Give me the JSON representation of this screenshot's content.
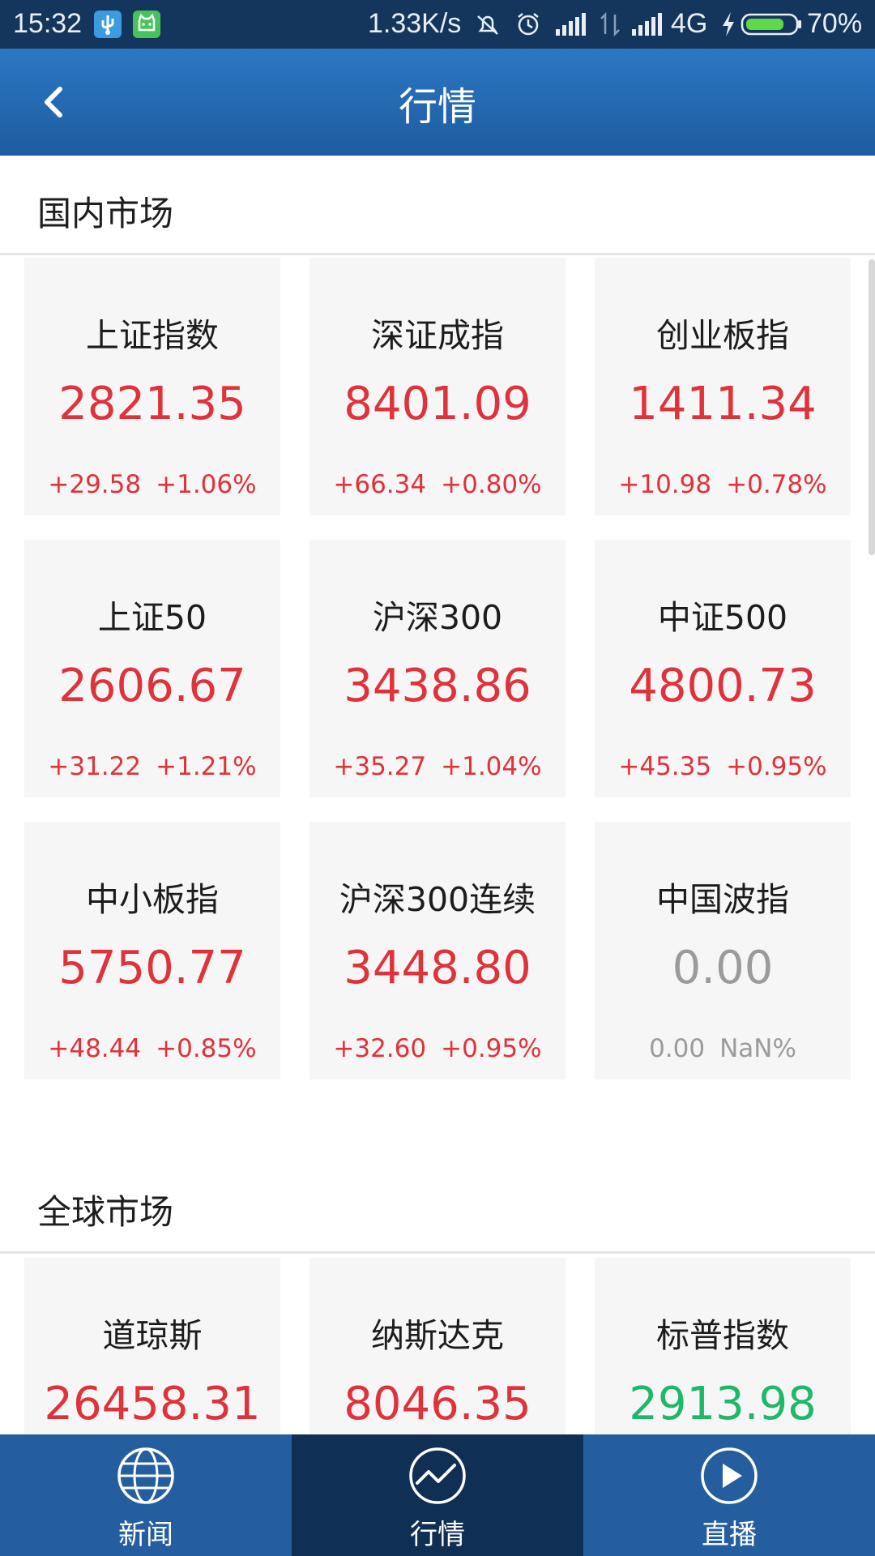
{
  "status_bar": {
    "time": "15:32",
    "speed": "1.33K/s",
    "network": "4G",
    "battery": "70%",
    "icons": [
      "usb-icon",
      "cat-app-icon",
      "mute-icon",
      "alarm-icon",
      "signal-icon",
      "data-arrows-icon",
      "signal-icon",
      "charging-icon",
      "battery-icon"
    ]
  },
  "app_bar": {
    "title": "行情",
    "back_icon": "back-arrow-icon"
  },
  "domestic": {
    "title": "国内市场",
    "cards": [
      {
        "name": "上证指数",
        "value": "2821.35",
        "change": "+29.58",
        "pct": "+1.06%"
      },
      {
        "name": "深证成指",
        "value": "8401.09",
        "change": "+66.34",
        "pct": "+0.80%"
      },
      {
        "name": "创业板指",
        "value": "1411.34",
        "change": "+10.98",
        "pct": "+0.78%"
      },
      {
        "name": "上证50",
        "value": "2606.67",
        "change": "+31.22",
        "pct": "+1.21%"
      },
      {
        "name": "沪深300",
        "value": "3438.86",
        "change": "+35.27",
        "pct": "+1.04%"
      },
      {
        "name": "中证500",
        "value": "4800.73",
        "change": "+45.35",
        "pct": "+0.95%"
      },
      {
        "name": "中小板指",
        "value": "5750.77",
        "change": "+48.44",
        "pct": "+0.85%"
      },
      {
        "name": "沪深300连续",
        "value": "3448.80",
        "change": "+32.60",
        "pct": "+0.95%"
      },
      {
        "name": "中国波指",
        "value": "0.00",
        "change": "0.00",
        "pct": "NaN%"
      }
    ]
  },
  "global": {
    "title": "全球市场",
    "cards": [
      {
        "name": "道琼斯",
        "value": "26458.31"
      },
      {
        "name": "纳斯达克",
        "value": "8046.35"
      },
      {
        "name": "标普指数",
        "value": "2913.98"
      }
    ]
  },
  "colors": {
    "up": "#e0323a",
    "down": "#1fb86a",
    "flat": "#9b9b9b",
    "brand": "#255e9e",
    "active_tab": "#0f2f54"
  },
  "bottom_nav": {
    "items": [
      {
        "label": "新闻",
        "icon": "globe-icon"
      },
      {
        "label": "行情",
        "icon": "chart-line-icon",
        "active": true
      },
      {
        "label": "直播",
        "icon": "play-icon"
      }
    ]
  }
}
